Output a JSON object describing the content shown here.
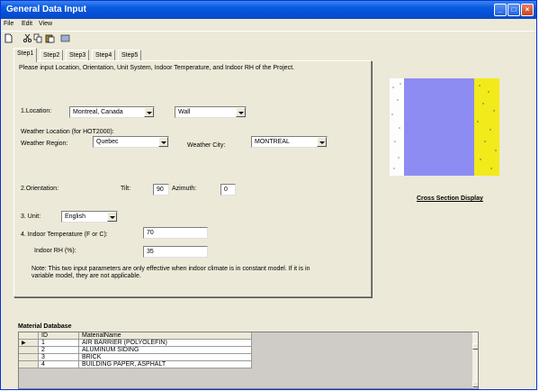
{
  "window": {
    "title": "General Data  Input"
  },
  "menu": [
    "File",
    "Edit",
    "View"
  ],
  "toolbar": {
    "icons": [
      "new-icon",
      "cut-icon",
      "copy-icon",
      "paste-icon",
      "undo-icon"
    ]
  },
  "tabs": [
    "Step1",
    "Step2",
    "Step3",
    "Step4",
    "Step5"
  ],
  "step1": {
    "instructions": "Please input Location, Orientation, Unit System, Indoor Temperature, and Indoor RH of the Project.",
    "location_label": "1.Location:",
    "location_value": "Montreal, Canada",
    "wall_value": "Wall",
    "weather_location_label": "Weather Location (for HOT2000):",
    "weather_region_label": "Weather Region:",
    "weather_region_value": "Quebec",
    "weather_city_label": "Weather City:",
    "weather_city_value": "MONTREAL",
    "orientation_label": "2.Orientation:",
    "tilt_label": "Tilt:",
    "tilt_value": "90",
    "azimuth_label": "Azimuth:",
    "azimuth_value": "0",
    "unit_label": "3. Unit:",
    "unit_value": "English",
    "indoor_temp_label": "4. Indoor Temperature (F or C):",
    "indoor_temp_value": "70",
    "indoor_rh_label": "Indoor RH (%):",
    "indoor_rh_value": "35",
    "note": "Note: This two input parameters are only effective when indoor climate is in constant model. If it is in variable model, they are not applicable."
  },
  "cross_section": {
    "title": "Cross Section Display",
    "colors": {
      "left": "#fdfdfd",
      "middle": "#8c8cf2",
      "right": "#f2ea1a"
    }
  },
  "material_db": {
    "title": "Material Database",
    "columns": [
      "ID",
      "MaterialName"
    ],
    "rows": [
      {
        "id": "1",
        "name": "AIR BARRIER (POLYOLEFIN)"
      },
      {
        "id": "2",
        "name": "ALUMINUM SIDING"
      },
      {
        "id": "3",
        "name": "BRICK"
      },
      {
        "id": "4",
        "name": "BUILDING PAPER, ASPHALT"
      }
    ],
    "row_indicator": "▶"
  }
}
